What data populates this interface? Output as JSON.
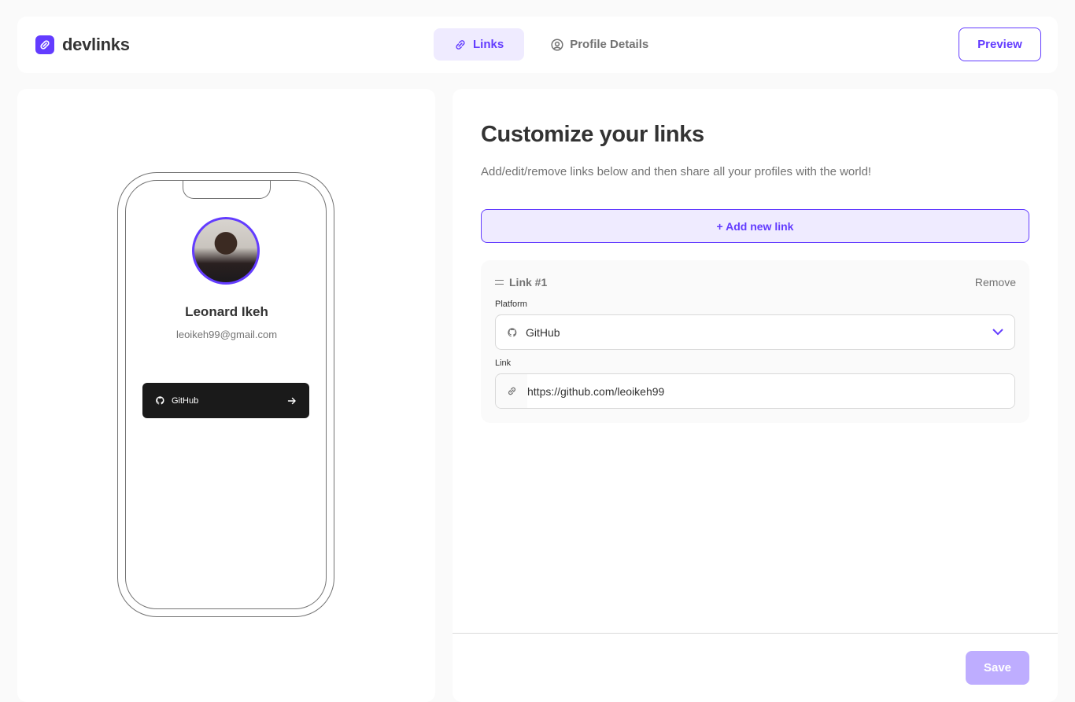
{
  "brand": {
    "name": "devlinks",
    "accent": "#633cff",
    "accent_light": "#efebff"
  },
  "nav": {
    "tabs": [
      {
        "label": "Links",
        "icon": "link-icon",
        "active": true
      },
      {
        "label": "Profile Details",
        "icon": "user-circle-icon",
        "active": false
      }
    ],
    "preview_label": "Preview"
  },
  "phone_preview": {
    "name": "Leonard Ikeh",
    "email": "leoikeh99@gmail.com",
    "links": [
      {
        "platform": "GitHub",
        "icon": "github-icon",
        "color": "#1a1a1a"
      }
    ]
  },
  "editor": {
    "title": "Customize your links",
    "subtitle": "Add/edit/remove links below and then share all your profiles with the world!",
    "add_label": "+ Add new link",
    "links": [
      {
        "label": "Link #1",
        "remove_label": "Remove",
        "platform_label": "Platform",
        "platform_value": "GitHub",
        "link_label": "Link",
        "link_value": "https://github.com/leoikeh99"
      }
    ],
    "save_label": "Save"
  }
}
